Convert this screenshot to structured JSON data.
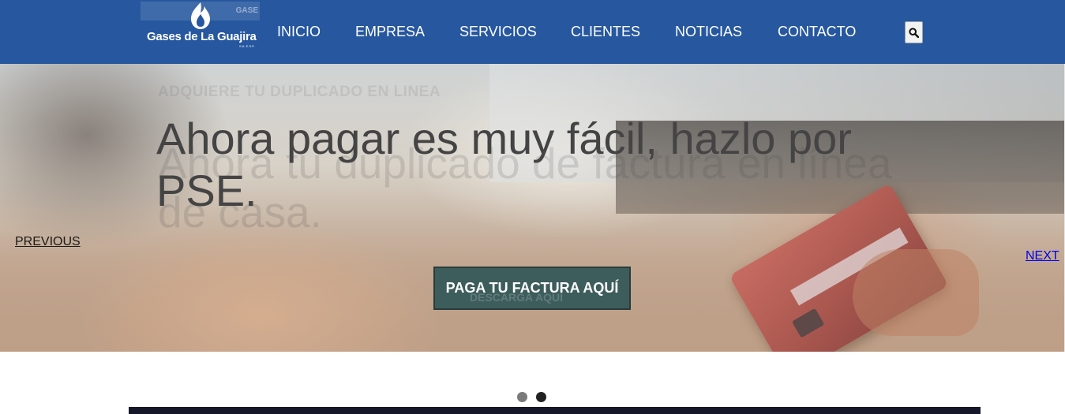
{
  "header": {
    "logo": {
      "name": "Gases de La Guajira",
      "sub": "S.A. E.S.P.",
      "ghost_text": "GASE"
    },
    "nav": [
      {
        "label": "INICIO"
      },
      {
        "label": "EMPRESA"
      },
      {
        "label": "SERVICIOS"
      },
      {
        "label": "CLIENTES"
      },
      {
        "label": "NOTICIAS"
      },
      {
        "label": "CONTACTO"
      }
    ],
    "search_icon": "search-icon"
  },
  "hero": {
    "ghost_kicker": "ADQUIERE TU DUPLICADO EN LINEA",
    "ghost_title": "Ahora tu duplicado de factura en línea de casa.",
    "title": "Ahora pagar es muy fácil, hazlo por PSE.",
    "previous": "PREVIOUS",
    "next": "NEXT",
    "cta": "PAGA TU FACTURA AQUÍ",
    "cta_ghost": "DESCARGA AQUÍ"
  },
  "carousel": {
    "slides": 2,
    "active": 2
  },
  "colors": {
    "header": "#26579f",
    "cta": "#3d5d5c",
    "title": "#444444",
    "footer_bar": "#16182a"
  }
}
